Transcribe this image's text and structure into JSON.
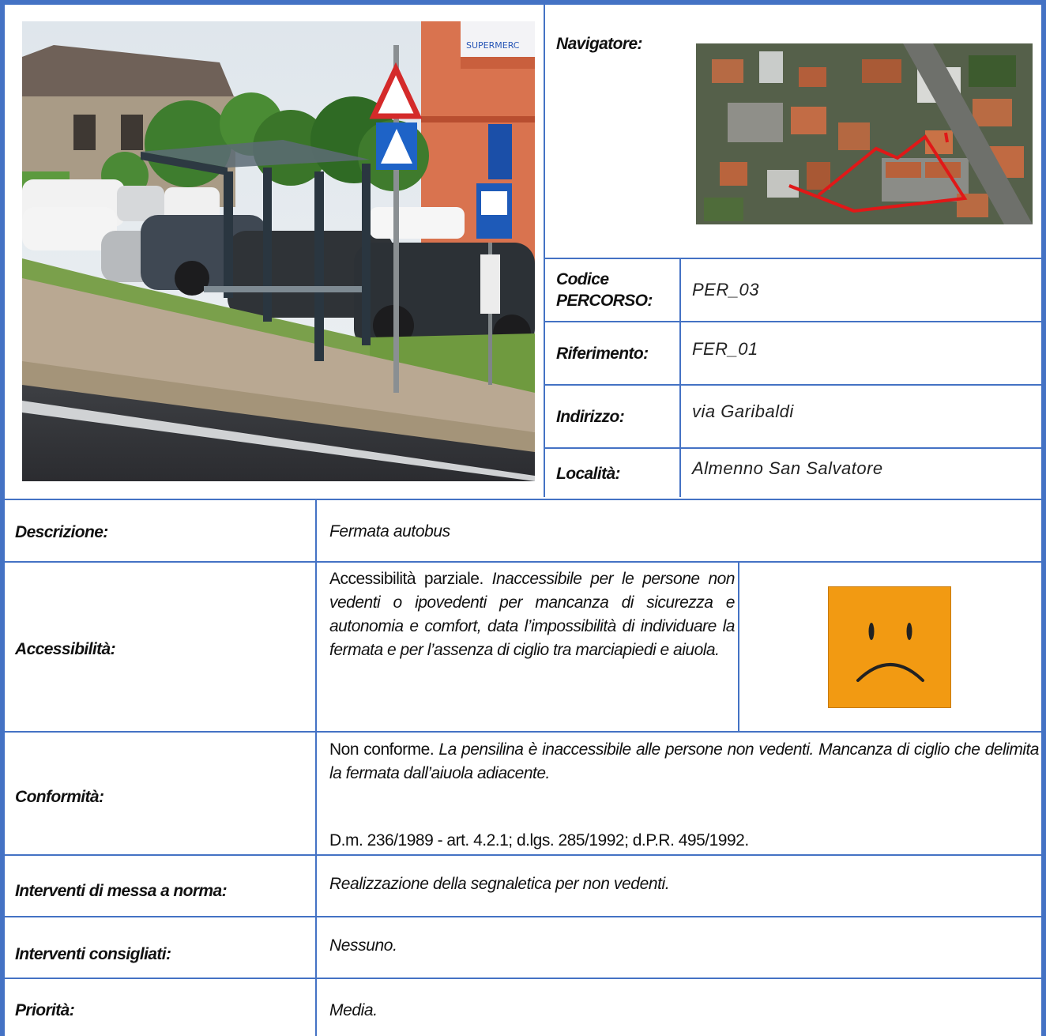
{
  "header": {
    "navigatore_label": "Navigatore:",
    "fields": [
      {
        "label": "Codice PERCORSO:",
        "value": "PER_03"
      },
      {
        "label": "Riferimento:",
        "value": "FER_01"
      },
      {
        "label": "Indirizzo:",
        "value": "via Garibaldi"
      },
      {
        "label": "Località:",
        "value": "Almenno San Salvatore"
      }
    ]
  },
  "photo": {
    "sign_text": "SUPERMERC"
  },
  "rows": {
    "descrizione": {
      "label": "Descrizione:",
      "value": "Fermata autobus"
    },
    "accessibilita": {
      "label": "Accessibilità:",
      "lead": "Accessibilità parziale.",
      "text": "Inaccessibile per le persone non vedenti o ipovedenti per mancanza di sicurezza e autonomia e comfort, data l’impossibilità di individuare la fermata e per l’assenza di ciglio tra marciapiedi e aiuola.",
      "face_color": "#f29a12"
    },
    "conformita": {
      "label": "Conformità:",
      "lead": "Non conforme.",
      "text": "La pensilina è inaccessibile alle persone non vedenti. Mancanza di ciglio che delimita la fermata dall’aiuola adiacente.",
      "references": "D.m. 236/1989 - art. 4.2.1; d.lgs. 285/1992; d.P.R. 495/1992."
    },
    "interventi_norma": {
      "label": "Interventi di messa a norma:",
      "value": "Realizzazione della segnaletica per non vedenti."
    },
    "interventi_consigliati": {
      "label": "Interventi consigliati:",
      "value": "Nessuno."
    },
    "priorita": {
      "label": "Priorità:",
      "value": "Media."
    }
  },
  "colors": {
    "border": "#4472c4",
    "route": "#e01818",
    "face": "#f29a12"
  }
}
